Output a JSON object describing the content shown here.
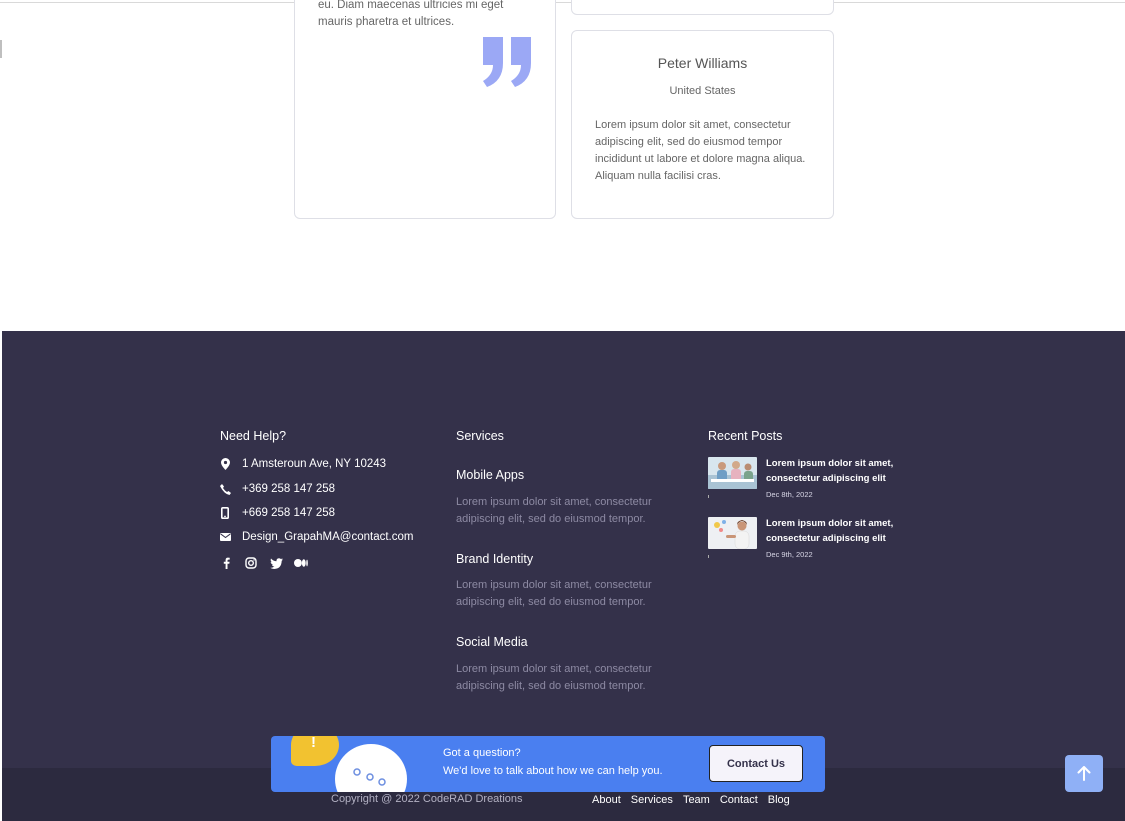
{
  "testimonials": {
    "left_card_text": "eu. Diam maecenas ultricies mi eget mauris pharetra et ultrices.",
    "right_card": {
      "name": "Peter Williams",
      "country": "United States",
      "body": "Lorem ipsum dolor sit amet, consectetur adipiscing elit, sed do eiusmod tempor incididunt ut labore et dolore magna aliqua. Aliquam nulla facilisi cras."
    },
    "quote_icon": "quote-icon",
    "quote_color": "#9ba8f5"
  },
  "footer": {
    "background": "#34314a",
    "need_help": {
      "title": "Need Help?",
      "address": "1 Amsteroun Ave, NY 10243",
      "phone": "+369 258 147 258",
      "mobile": "+669 258 147 258",
      "email": "Design_GrapahMA@contact.com",
      "social": [
        "facebook-icon",
        "instagram-icon",
        "twitter-icon",
        "medium-icon"
      ]
    },
    "services": {
      "title": "Services",
      "items": [
        {
          "title": "Mobile Apps",
          "desc": "Lorem ipsum dolor sit amet, consectetur adipiscing elit, sed do eiusmod tempor."
        },
        {
          "title": "Brand Identity",
          "desc": "Lorem ipsum dolor sit amet, consectetur adipiscing elit, sed do eiusmod tempor."
        },
        {
          "title": "Social Media",
          "desc": "Lorem ipsum dolor sit amet, consectetur adipiscing elit, sed do eiusmod tempor."
        }
      ]
    },
    "recent_posts": {
      "title": "Recent Posts",
      "items": [
        {
          "title": "Lorem ipsum dolor sit amet, consectetur adipiscing elit",
          "date": "Dec 8th, 2022"
        },
        {
          "title": "Lorem ipsum dolor sit amet, consectetur adipiscing elit",
          "date": "Dec 9th, 2022"
        }
      ]
    },
    "cta": {
      "line1": "Got a question?",
      "line2": "We'd love to talk about how we can help you.",
      "button": "Contact Us",
      "accent": "#4a7ff0"
    },
    "copyright": "Copyright @ 2022 CodeRAD Dreations",
    "links": [
      "About",
      "Services",
      "Team",
      "Contact",
      "Blog"
    ]
  }
}
